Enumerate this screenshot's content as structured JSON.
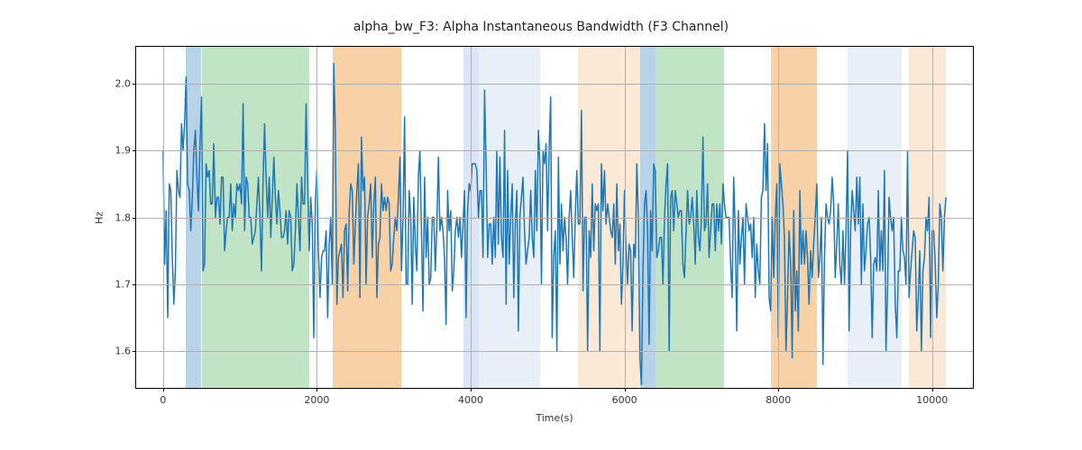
{
  "chart_data": {
    "type": "line",
    "title": "alpha_bw_F3: Alpha Instantaneous Bandwidth (F3 Channel)",
    "xlabel": "Time(s)",
    "ylabel": "Hz",
    "xlim": [
      -350,
      10530
    ],
    "ylim": [
      1.545,
      2.055
    ],
    "x_ticks": [
      0,
      2000,
      4000,
      6000,
      8000,
      10000
    ],
    "y_ticks": [
      1.6,
      1.7,
      1.8,
      1.9,
      2.0
    ],
    "bands": [
      {
        "x0": 300,
        "x1": 500,
        "color": "#72a5cf",
        "alpha": 0.5
      },
      {
        "x0": 500,
        "x1": 1900,
        "color": "#85c98d",
        "alpha": 0.5
      },
      {
        "x0": 2200,
        "x1": 3100,
        "color": "#f5b26b",
        "alpha": 0.6
      },
      {
        "x0": 3900,
        "x1": 4100,
        "color": "#aec7e9",
        "alpha": 0.45
      },
      {
        "x0": 4100,
        "x1": 4900,
        "color": "#d9e4f1",
        "alpha": 0.6
      },
      {
        "x0": 5400,
        "x1": 6200,
        "color": "#f9e0c5",
        "alpha": 0.7
      },
      {
        "x0": 6200,
        "x1": 6400,
        "color": "#72a5cf",
        "alpha": 0.5
      },
      {
        "x0": 6400,
        "x1": 7300,
        "color": "#85c98d",
        "alpha": 0.5
      },
      {
        "x0": 7900,
        "x1": 8500,
        "color": "#f5b26b",
        "alpha": 0.6
      },
      {
        "x0": 8900,
        "x1": 9600,
        "color": "#d9e4f1",
        "alpha": 0.6
      },
      {
        "x0": 9700,
        "x1": 10180,
        "color": "#f9e0c5",
        "alpha": 0.7
      }
    ],
    "series": [
      {
        "name": "alpha_bw_F3",
        "color": "#1f77b4",
        "x_start": 0,
        "x_step": 20,
        "values": [
          1.9,
          1.73,
          1.81,
          1.65,
          1.85,
          1.84,
          1.74,
          1.67,
          1.72,
          1.87,
          1.84,
          1.83,
          1.94,
          1.9,
          1.94,
          2.01,
          1.85,
          1.84,
          1.78,
          1.83,
          1.9,
          1.93,
          1.86,
          1.81,
          1.91,
          1.98,
          1.72,
          1.73,
          1.88,
          1.86,
          1.87,
          1.82,
          1.82,
          1.91,
          1.8,
          1.83,
          1.83,
          1.79,
          1.86,
          1.86,
          1.75,
          1.78,
          1.8,
          1.8,
          1.85,
          1.78,
          1.82,
          1.8,
          1.85,
          1.84,
          1.85,
          1.82,
          1.97,
          1.78,
          1.86,
          1.85,
          1.8,
          1.8,
          1.76,
          1.77,
          1.78,
          1.82,
          1.86,
          1.8,
          1.72,
          1.85,
          1.94,
          1.86,
          1.8,
          1.86,
          1.77,
          1.83,
          1.89,
          1.83,
          1.79,
          1.84,
          1.81,
          1.77,
          1.77,
          1.78,
          1.81,
          1.76,
          1.81,
          1.8,
          1.72,
          1.73,
          1.78,
          1.85,
          1.8,
          1.75,
          1.86,
          1.82,
          1.82,
          1.97,
          1.85,
          1.75,
          1.83,
          1.79,
          1.62,
          1.82,
          1.87,
          1.75,
          1.68,
          1.74,
          1.75,
          1.75,
          1.78,
          1.65,
          1.76,
          1.8,
          1.7,
          2.03,
          1.93,
          1.67,
          1.74,
          1.75,
          1.76,
          1.68,
          1.78,
          1.79,
          1.69,
          1.81,
          1.85,
          1.84,
          1.73,
          1.79,
          1.84,
          1.88,
          1.68,
          1.92,
          1.84,
          1.86,
          1.7,
          1.8,
          1.82,
          1.85,
          1.74,
          1.82,
          1.86,
          1.68,
          1.76,
          1.77,
          1.85,
          1.81,
          1.83,
          1.81,
          1.83,
          1.82,
          1.72,
          1.73,
          1.77,
          1.8,
          1.78,
          1.83,
          1.89,
          1.72,
          1.8,
          1.95,
          1.7,
          1.7,
          1.84,
          1.8,
          1.67,
          1.83,
          1.76,
          1.72,
          1.86,
          1.9,
          1.78,
          1.66,
          1.86,
          1.74,
          1.8,
          1.7,
          1.71,
          1.8,
          1.8,
          1.72,
          1.79,
          1.89,
          1.78,
          1.8,
          1.78,
          1.74,
          1.64,
          1.84,
          1.78,
          1.81,
          1.69,
          1.72,
          1.78,
          1.8,
          1.77,
          1.8,
          1.74,
          1.79,
          1.84,
          1.65,
          1.81,
          1.85,
          1.84,
          1.88,
          1.88,
          1.88,
          1.87,
          1.8,
          1.84,
          1.84,
          1.74,
          1.99,
          1.88,
          1.74,
          1.79,
          1.79,
          1.73,
          1.8,
          1.74,
          1.9,
          1.76,
          1.89,
          1.77,
          1.74,
          1.93,
          1.67,
          1.87,
          1.73,
          1.8,
          1.85,
          1.68,
          1.79,
          1.84,
          1.63,
          1.8,
          1.83,
          1.86,
          1.78,
          1.73,
          1.75,
          1.77,
          1.84,
          1.77,
          1.74,
          1.87,
          1.78,
          1.93,
          1.88,
          1.7,
          1.9,
          1.88,
          1.91,
          1.78,
          1.9,
          1.98,
          1.62,
          1.74,
          1.78,
          1.6,
          1.89,
          1.73,
          1.82,
          1.75,
          1.8,
          1.77,
          1.7,
          1.8,
          1.84,
          1.77,
          1.71,
          1.8,
          1.87,
          1.79,
          1.79,
          1.96,
          1.69,
          1.8,
          1.8,
          1.6,
          1.78,
          1.74,
          1.85,
          1.75,
          1.82,
          1.81,
          1.82,
          1.6,
          1.88,
          1.81,
          1.87,
          1.79,
          1.82,
          1.8,
          1.78,
          1.77,
          1.82,
          1.73,
          1.85,
          1.75,
          1.79,
          1.67,
          1.73,
          1.84,
          1.75,
          1.7,
          1.76,
          1.75,
          1.63,
          1.76,
          1.74,
          1.88,
          1.8,
          1.59,
          1.55,
          1.72,
          1.82,
          1.84,
          1.78,
          1.61,
          1.81,
          1.75,
          1.88,
          1.87,
          1.74,
          1.75,
          1.77,
          1.77,
          1.7,
          1.8,
          1.85,
          1.88,
          1.6,
          1.83,
          1.84,
          1.78,
          1.84,
          1.82,
          1.8,
          1.81,
          1.81,
          1.73,
          1.71,
          1.78,
          1.84,
          1.79,
          1.8,
          1.83,
          1.79,
          1.73,
          1.84,
          1.77,
          1.75,
          1.8,
          1.92,
          1.78,
          1.79,
          1.85,
          1.74,
          1.78,
          1.82,
          1.82,
          1.75,
          1.82,
          1.78,
          1.82,
          1.76,
          1.85,
          1.82,
          1.8,
          1.8,
          1.8,
          1.73,
          1.68,
          1.86,
          1.78,
          1.63,
          1.81,
          1.73,
          1.77,
          1.8,
          1.7,
          1.82,
          1.8,
          1.78,
          1.79,
          1.74,
          1.8,
          1.68,
          1.76,
          1.72,
          1.7,
          1.83,
          1.84,
          1.94,
          1.84,
          1.91,
          1.68,
          1.66,
          1.8,
          1.71,
          1.8,
          1.85,
          1.62,
          1.88,
          1.85,
          1.82,
          1.77,
          1.6,
          1.68,
          1.78,
          1.73,
          1.59,
          1.81,
          1.66,
          1.72,
          1.63,
          1.84,
          1.73,
          1.78,
          1.73,
          1.78,
          1.74,
          1.67,
          1.75,
          1.71,
          1.76,
          1.8,
          1.85,
          1.71,
          1.74,
          1.8,
          1.58,
          1.74,
          1.82,
          1.8,
          1.79,
          1.81,
          1.86,
          1.82,
          1.71,
          1.76,
          1.82,
          1.73,
          1.7,
          1.78,
          1.7,
          1.78,
          1.9,
          1.63,
          1.78,
          1.84,
          1.81,
          1.78,
          1.86,
          1.79,
          1.86,
          1.7,
          1.82,
          1.72,
          1.75,
          1.79,
          1.8,
          1.74,
          1.62,
          1.73,
          1.74,
          1.72,
          1.84,
          1.72,
          1.78,
          1.72,
          1.87,
          1.6,
          1.69,
          1.83,
          1.8,
          1.78,
          1.8,
          1.67,
          1.62,
          1.72,
          1.72,
          1.8,
          1.75,
          1.74,
          1.7,
          1.9,
          1.68,
          1.72,
          1.75,
          1.78,
          1.77,
          1.63,
          1.68,
          1.75,
          1.6,
          1.72,
          1.74,
          1.8,
          1.78,
          1.83,
          1.62,
          1.78,
          1.78,
          1.73,
          1.65,
          1.7,
          1.82,
          1.8,
          1.72,
          1.8,
          1.83
        ]
      }
    ]
  }
}
